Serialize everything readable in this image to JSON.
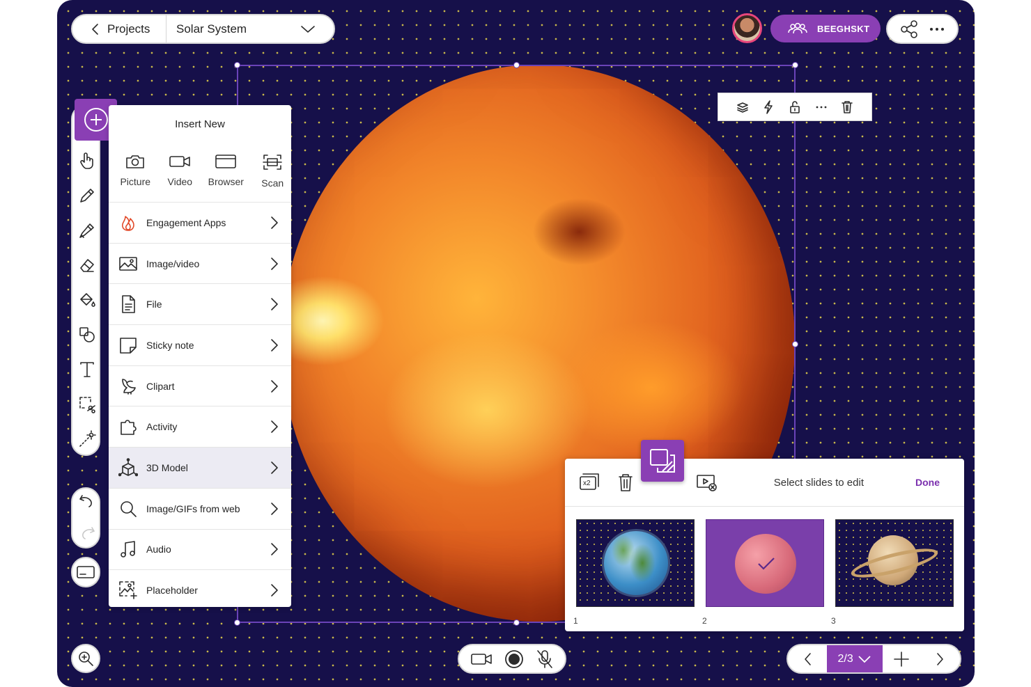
{
  "nav": {
    "back_label": "Projects",
    "project_title": "Solar System"
  },
  "team": {
    "name": "BEEGHSKT",
    "color": "#8a3fb4"
  },
  "insert_panel": {
    "header": "Insert New",
    "quick": [
      {
        "label": "Picture",
        "icon": "camera-icon"
      },
      {
        "label": "Video",
        "icon": "video-camera-icon"
      },
      {
        "label": "Browser",
        "icon": "browser-icon"
      },
      {
        "label": "Scan",
        "icon": "scan-icon"
      }
    ],
    "items": [
      {
        "label": "Engagement Apps",
        "icon": "flame-icon"
      },
      {
        "label": "Image/video",
        "icon": "image-icon"
      },
      {
        "label": "File",
        "icon": "file-icon"
      },
      {
        "label": "Sticky note",
        "icon": "sticky-note-icon"
      },
      {
        "label": "Clipart",
        "icon": "clipart-icon"
      },
      {
        "label": "Activity",
        "icon": "puzzle-icon"
      },
      {
        "label": "3D Model",
        "icon": "cube-icon",
        "selected": true
      },
      {
        "label": "Image/GIFs from web",
        "icon": "search-icon"
      },
      {
        "label": "Audio",
        "icon": "music-icon"
      },
      {
        "label": "Placeholder",
        "icon": "placeholder-icon"
      }
    ]
  },
  "slide_editor": {
    "title": "Select slides to edit",
    "done_label": "Done",
    "duplicate_badge": "x2",
    "slides": [
      {
        "number": "1",
        "content": "earth"
      },
      {
        "number": "2",
        "content": "sun",
        "selected": true
      },
      {
        "number": "3",
        "content": "saturn"
      }
    ]
  },
  "pager": {
    "current": "2/3"
  },
  "colors": {
    "accent": "#8a3fb4",
    "canvas": "#16104a",
    "grid_dot": "#c9b84a"
  }
}
